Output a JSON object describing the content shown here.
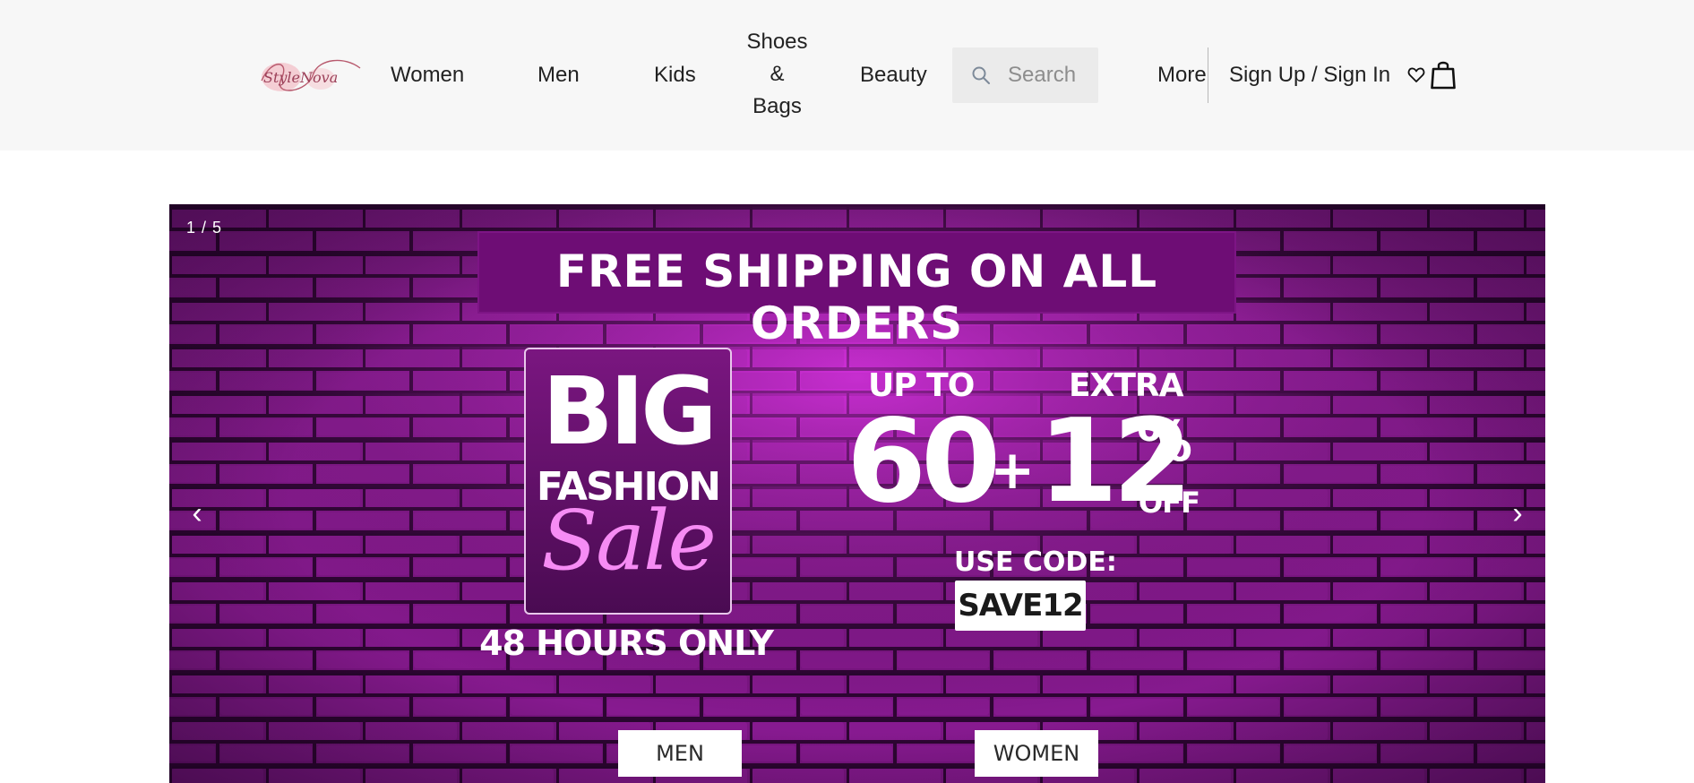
{
  "header": {
    "logo_text": "StyleNova",
    "nav": [
      "Women",
      "Men",
      "Kids",
      "Shoes & Bags",
      "Beauty"
    ],
    "search_placeholder": "Search",
    "more_label": "More",
    "signin_label": "Sign Up / Sign In",
    "icons": [
      "search-icon",
      "heart-icon",
      "shopping-bag-icon"
    ]
  },
  "banner": {
    "counter": "1 / 5",
    "prev_arrow": "‹",
    "next_arrow": "›",
    "shipping_text": "FREE SHIPPING ON ALL ORDERS",
    "big": "BIG",
    "fashion": "FASHION",
    "sale": "Sale",
    "hours": "48 HOURS ONLY",
    "up_to": "UP TO",
    "extra": "EXTRA",
    "sixty": "60",
    "plus": "+",
    "twelve": "12",
    "percent": "%",
    "off": "OFF",
    "use_code": "USE CODE:",
    "code": "SAVE12",
    "cta_men": "MEN",
    "cta_women": "WOMEN",
    "colors": {
      "banner_bg": "#7a1582",
      "sale_pink": "#f68cf4",
      "brick_mortar": "#2a0630"
    }
  }
}
